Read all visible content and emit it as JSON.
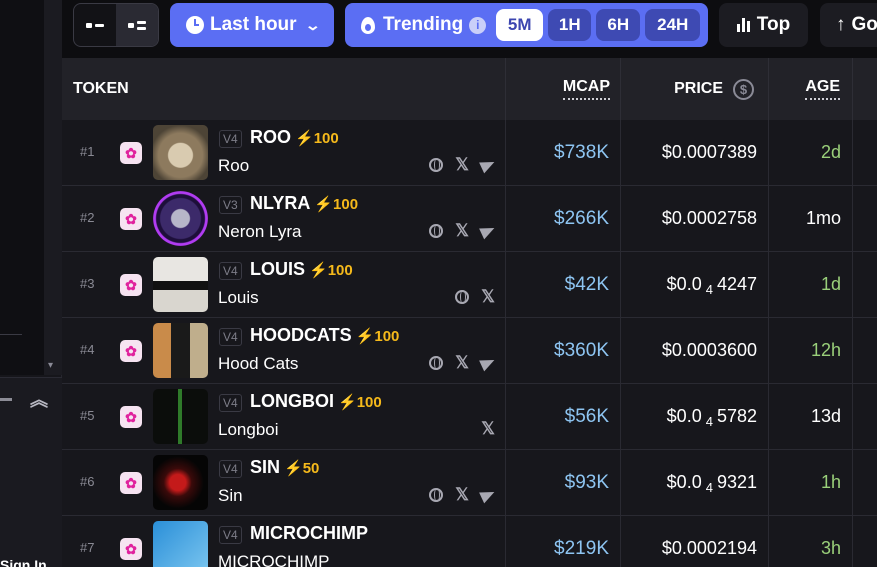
{
  "toolbar": {
    "time_label": "Last hour",
    "trending_label": "Trending",
    "timeframes": [
      "5M",
      "1H",
      "6H",
      "24H"
    ],
    "active_timeframe": "5M",
    "top_label": "Top",
    "go_label": "Go"
  },
  "sidebar": {
    "signin_label": "Sign In"
  },
  "table": {
    "headers": {
      "token": "TOKEN",
      "mcap": "MCAP",
      "price": "PRICE",
      "age": "AGE"
    },
    "rows": [
      {
        "rank": "#1",
        "version": "V4",
        "symbol": "ROO",
        "boost": "100",
        "name": "Roo",
        "socials": [
          "globe",
          "x",
          "telegram"
        ],
        "mcap": "$738K",
        "price": "$0.0007389",
        "age": "2d",
        "age_color": "green"
      },
      {
        "rank": "#2",
        "version": "V3",
        "symbol": "NLYRA",
        "boost": "100",
        "name": "Neron Lyra",
        "socials": [
          "globe",
          "x",
          "telegram"
        ],
        "mcap": "$266K",
        "price": "$0.0002758",
        "age": "1mo",
        "age_color": "white"
      },
      {
        "rank": "#3",
        "version": "V4",
        "symbol": "LOUIS",
        "boost": "100",
        "name": "Louis",
        "socials": [
          "globe",
          "x"
        ],
        "mcap": "$42K",
        "price_prefix": "$0.0",
        "price_sub": "4",
        "price_suffix": "4247",
        "age": "1d",
        "age_color": "green"
      },
      {
        "rank": "#4",
        "version": "V4",
        "symbol": "HOODCATS",
        "boost": "100",
        "name": "Hood Cats",
        "socials": [
          "globe",
          "x",
          "telegram"
        ],
        "mcap": "$360K",
        "price": "$0.0003600",
        "age": "12h",
        "age_color": "green"
      },
      {
        "rank": "#5",
        "version": "V4",
        "symbol": "LONGBOI",
        "boost": "100",
        "name": "Longboi",
        "socials": [
          "x"
        ],
        "mcap": "$56K",
        "price_prefix": "$0.0",
        "price_sub": "4",
        "price_suffix": "5782",
        "age": "13d",
        "age_color": "white"
      },
      {
        "rank": "#6",
        "version": "V4",
        "symbol": "SIN",
        "boost": "50",
        "name": "Sin",
        "socials": [
          "globe",
          "x",
          "telegram"
        ],
        "mcap": "$93K",
        "price_prefix": "$0.0",
        "price_sub": "4",
        "price_suffix": "9321",
        "age": "1h",
        "age_color": "green"
      },
      {
        "rank": "#7",
        "version": "V4",
        "symbol": "MICROCHIMP",
        "boost": "",
        "name": "MICROCHIMP",
        "socials": [],
        "mcap": "$219K",
        "price": "$0.0002194",
        "age": "3h",
        "age_color": "green"
      }
    ]
  },
  "colors": {
    "accent": "#5b6ef3",
    "mcap": "#8ec5f2",
    "age_green": "#9ad07a",
    "boost": "#f5b91b"
  }
}
